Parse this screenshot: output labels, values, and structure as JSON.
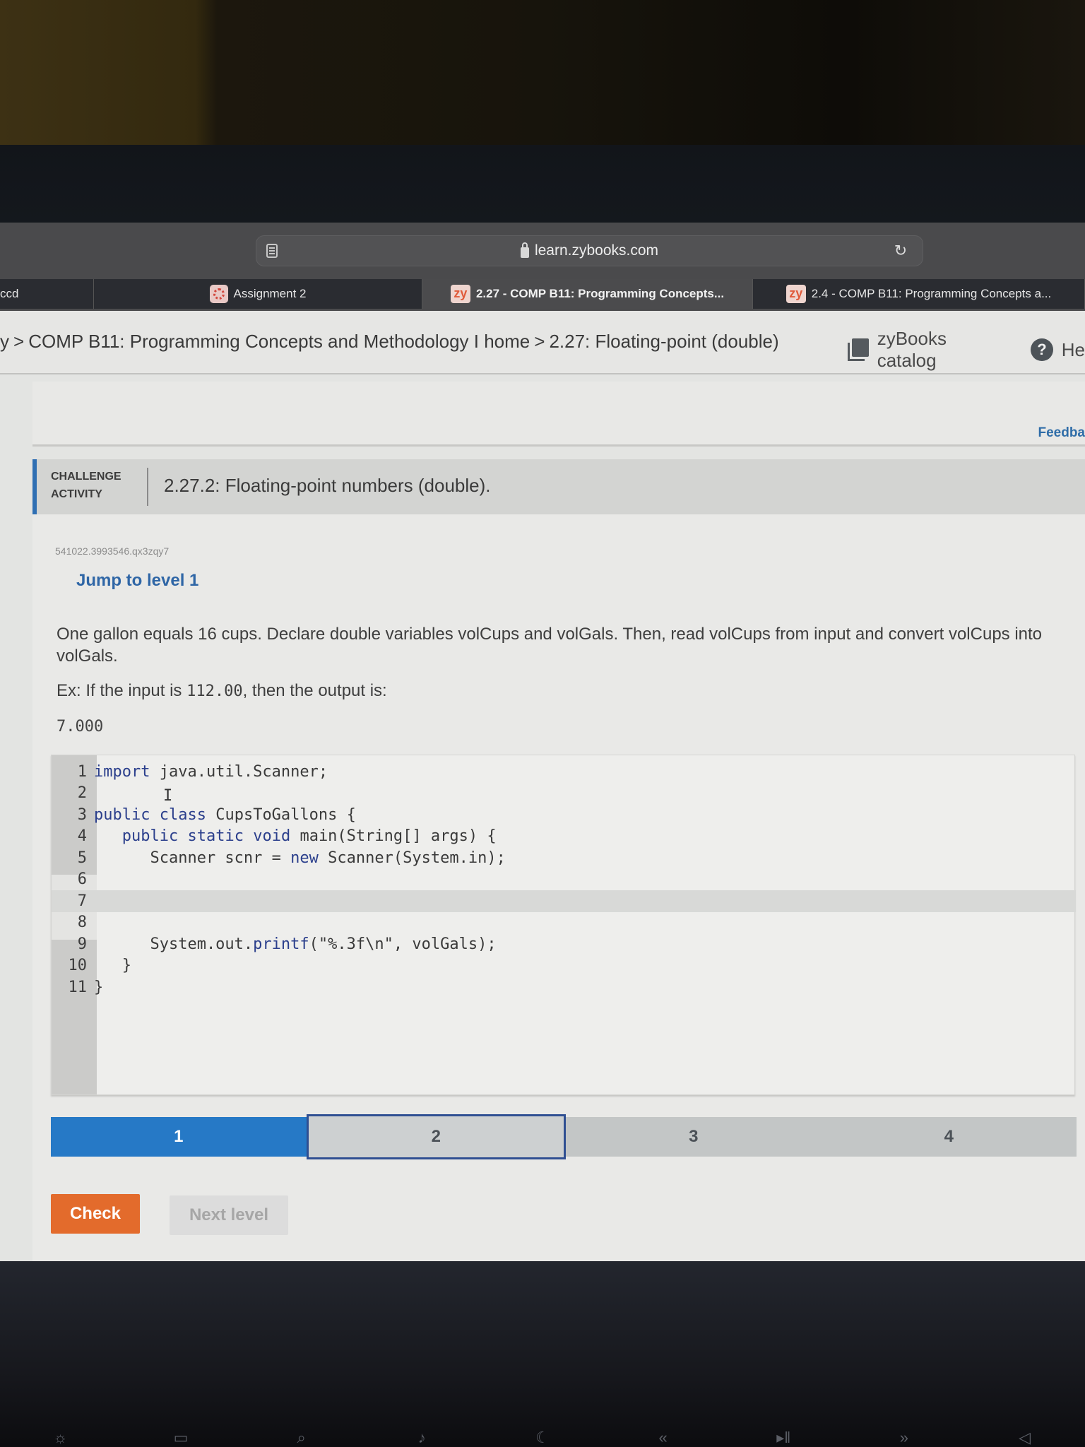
{
  "browser": {
    "url": "learn.zybooks.com",
    "tabs": [
      {
        "label": "ccd",
        "icon": "none",
        "active": false
      },
      {
        "label": "Assignment 2",
        "icon": "canvas-icon",
        "active": false
      },
      {
        "label": "2.27 - COMP B11: Programming Concepts...",
        "icon": "zybooks-icon",
        "active": true
      },
      {
        "label": "2.4 - COMP B11: Programming Concepts a...",
        "icon": "zybooks-icon",
        "active": false
      }
    ],
    "favicon_text": "zy"
  },
  "breadcrumb": {
    "items": [
      "y",
      "COMP B11: Programming Concepts and Methodology I home",
      "2.27: Floating-point (double)"
    ],
    "separator": ">"
  },
  "top_links": {
    "catalog": "zyBooks catalog",
    "help": "He",
    "help_glyph": "?"
  },
  "feedback": "Feedba",
  "challenge": {
    "label_line1": "CHALLENGE",
    "label_line2": "ACTIVITY",
    "title": "2.27.2: Floating-point numbers (double).",
    "activity_id": "541022.3993546.qx3zqy7",
    "jump_link": "Jump to level 1",
    "prompt": "One gallon equals 16 cups. Declare double variables volCups and volGals. Then, read volCups from input and convert volCups into volGals.",
    "example_prefix": "Ex: If the input is ",
    "example_input": "112.00",
    "example_suffix": ", then the output is:",
    "example_output": "7.000"
  },
  "editor": {
    "active_line": 7,
    "lines": [
      {
        "n": "1",
        "code": "import java.util.Scanner;"
      },
      {
        "n": "2",
        "code": ""
      },
      {
        "n": "3",
        "code": "public class CupsToGallons {"
      },
      {
        "n": "4",
        "code": "   public static void main(String[] args) {"
      },
      {
        "n": "5",
        "code": "      Scanner scnr = new Scanner(System.in);"
      },
      {
        "n": "6",
        "code": ""
      },
      {
        "n": "7",
        "code": ""
      },
      {
        "n": "8",
        "code": ""
      },
      {
        "n": "9",
        "code": "      System.out.printf(\"%.3f\\n\", volGals);"
      },
      {
        "n": "10",
        "code": "   }"
      },
      {
        "n": "11",
        "code": "}"
      }
    ]
  },
  "levels": {
    "items": [
      "1",
      "2",
      "3",
      "4"
    ],
    "completed": 1,
    "current": 2,
    "colors": {
      "done": "#2679c6",
      "current_border": "#2f4f92"
    }
  },
  "buttons": {
    "check": "Check",
    "next_level": "Next level",
    "check_color": "#e36b2c"
  },
  "keyboard_icons": [
    "brightness-icon",
    "mission-control-icon",
    "search-icon",
    "microphone-icon",
    "moon-icon",
    "rewind-icon",
    "play-pause-icon",
    "fast-forward-icon",
    "mute-icon"
  ]
}
